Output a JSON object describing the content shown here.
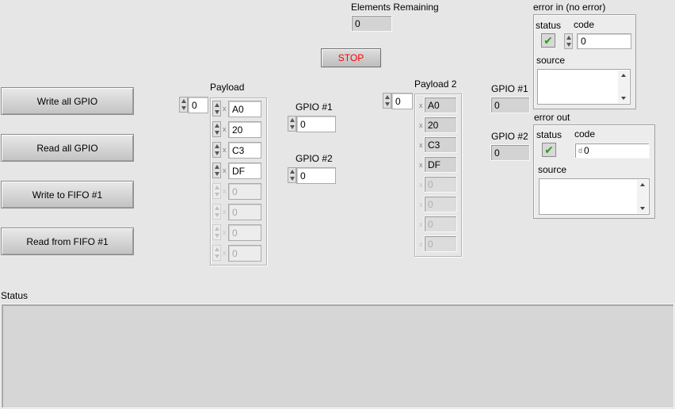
{
  "buttons": {
    "write_all_gpio": "Write all GPIO",
    "read_all_gpio": "Read all GPIO",
    "write_fifo1": "Write to FIFO #1",
    "read_fifo1": "Read from FIFO #1",
    "stop": "STOP"
  },
  "elements_remaining": {
    "label": "Elements Remaining",
    "value": "0"
  },
  "payload": {
    "label": "Payload",
    "index": "0",
    "radix": "x",
    "values": [
      "A0",
      "20",
      "C3",
      "DF",
      "0",
      "0",
      "0",
      "0"
    ]
  },
  "payload2": {
    "label": "Payload 2",
    "index": "0",
    "radix": "x",
    "values": [
      "A0",
      "20",
      "C3",
      "DF",
      "0",
      "0",
      "0",
      "0"
    ]
  },
  "gpio_controls": {
    "gpio1_label": "GPIO #1",
    "gpio1_value": "0",
    "gpio2_label": "GPIO #2",
    "gpio2_value": "0"
  },
  "gpio_indicators": {
    "gpio1_label": "GPIO #1",
    "gpio1_value": "0",
    "gpio2_label": "GPIO #2",
    "gpio2_value": "0"
  },
  "error_in": {
    "label": "error in (no error)",
    "status_label": "status",
    "code_label": "code",
    "code_value": "0",
    "source_label": "source",
    "check_glyph": "✔"
  },
  "error_out": {
    "label": "error out",
    "status_label": "status",
    "code_label": "code",
    "code_value": "0",
    "radix": "d",
    "source_label": "source",
    "check_glyph": "✔"
  },
  "status": {
    "label": "Status"
  }
}
